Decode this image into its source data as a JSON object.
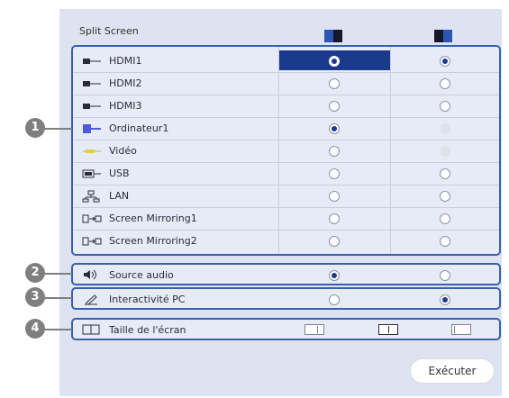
{
  "title": "Split Screen",
  "header_icons": [
    "split-left-icon",
    "split-right-icon"
  ],
  "sources": [
    {
      "label": "HDMI1",
      "icon": "hdmi-icon",
      "left": "selected-highlight",
      "right": "on"
    },
    {
      "label": "HDMI2",
      "icon": "hdmi-icon",
      "left": "off",
      "right": "off"
    },
    {
      "label": "HDMI3",
      "icon": "hdmi-icon",
      "left": "off",
      "right": "off"
    },
    {
      "label": "Ordinateur1",
      "icon": "computer-icon",
      "left": "on",
      "right": "disabled"
    },
    {
      "label": "Vidéo",
      "icon": "video-icon",
      "left": "off",
      "right": "disabled"
    },
    {
      "label": "USB",
      "icon": "usb-icon",
      "left": "off",
      "right": "off"
    },
    {
      "label": "LAN",
      "icon": "lan-icon",
      "left": "off",
      "right": "off"
    },
    {
      "label": "Screen Mirroring1",
      "icon": "screen-mirroring-icon",
      "left": "off",
      "right": "off"
    },
    {
      "label": "Screen Mirroring2",
      "icon": "screen-mirroring-icon",
      "left": "off",
      "right": "off"
    }
  ],
  "audio": {
    "label": "Source audio",
    "icon": "speaker-icon",
    "left": "on",
    "right": "off"
  },
  "interactive": {
    "label": "Interactivité PC",
    "icon": "pen-icon",
    "left": "off",
    "right": "on"
  },
  "screen_size": {
    "label": "Taille de l'écran",
    "icon": "screen-size-icon"
  },
  "markers": [
    "1",
    "2",
    "3",
    "4"
  ],
  "execute_label": "Exécuter",
  "colors": {
    "accent": "#1b3a8c",
    "frame": "#3a5fb0",
    "panel": "#dde3f0",
    "marker": "#7f7f7f"
  }
}
